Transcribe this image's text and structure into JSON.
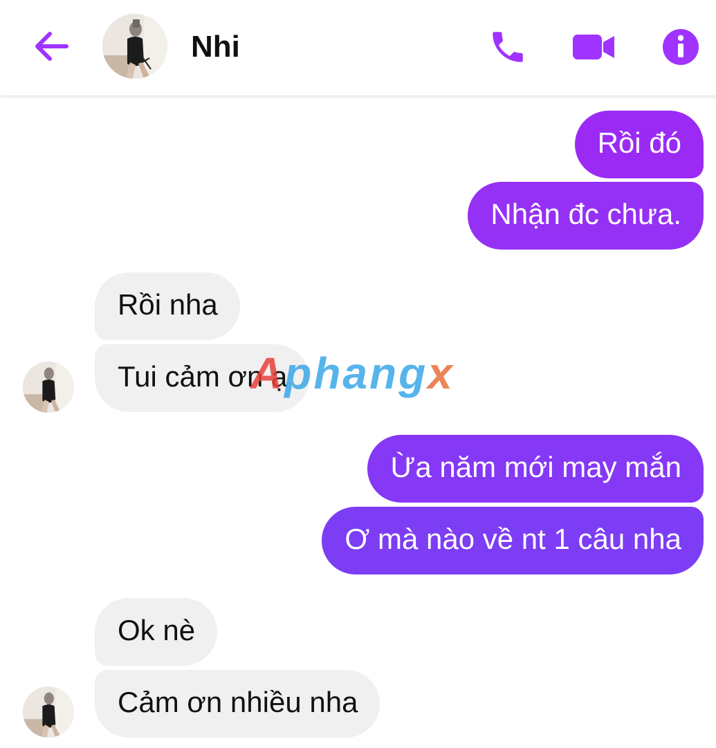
{
  "header": {
    "contact_name": "Nhi",
    "icons": [
      "back-arrow-icon",
      "phone-icon",
      "video-camera-icon",
      "info-icon"
    ]
  },
  "messages": [
    {
      "direction": "outgoing",
      "text": "Rồi đó"
    },
    {
      "direction": "outgoing",
      "text": "Nhận đc chưa."
    },
    {
      "direction": "incoming",
      "text": "Rồi nha"
    },
    {
      "direction": "incoming",
      "text": "Tui cảm ơn ạ"
    },
    {
      "direction": "outgoing",
      "text": "Ừa năm mới may mắn"
    },
    {
      "direction": "outgoing",
      "text": "Ơ mà nào về nt 1 câu nha"
    },
    {
      "direction": "incoming",
      "text": "Ok nè"
    },
    {
      "direction": "incoming",
      "text": "Cảm ơn nhiều nha"
    }
  ],
  "watermark": {
    "text": "Aphangx"
  },
  "colors": {
    "accent": "#a033ff",
    "outgoing_top": "#9a2cf5",
    "outgoing_bottom": "#7a3ef5",
    "incoming_bubble": "#f0f0f0"
  }
}
